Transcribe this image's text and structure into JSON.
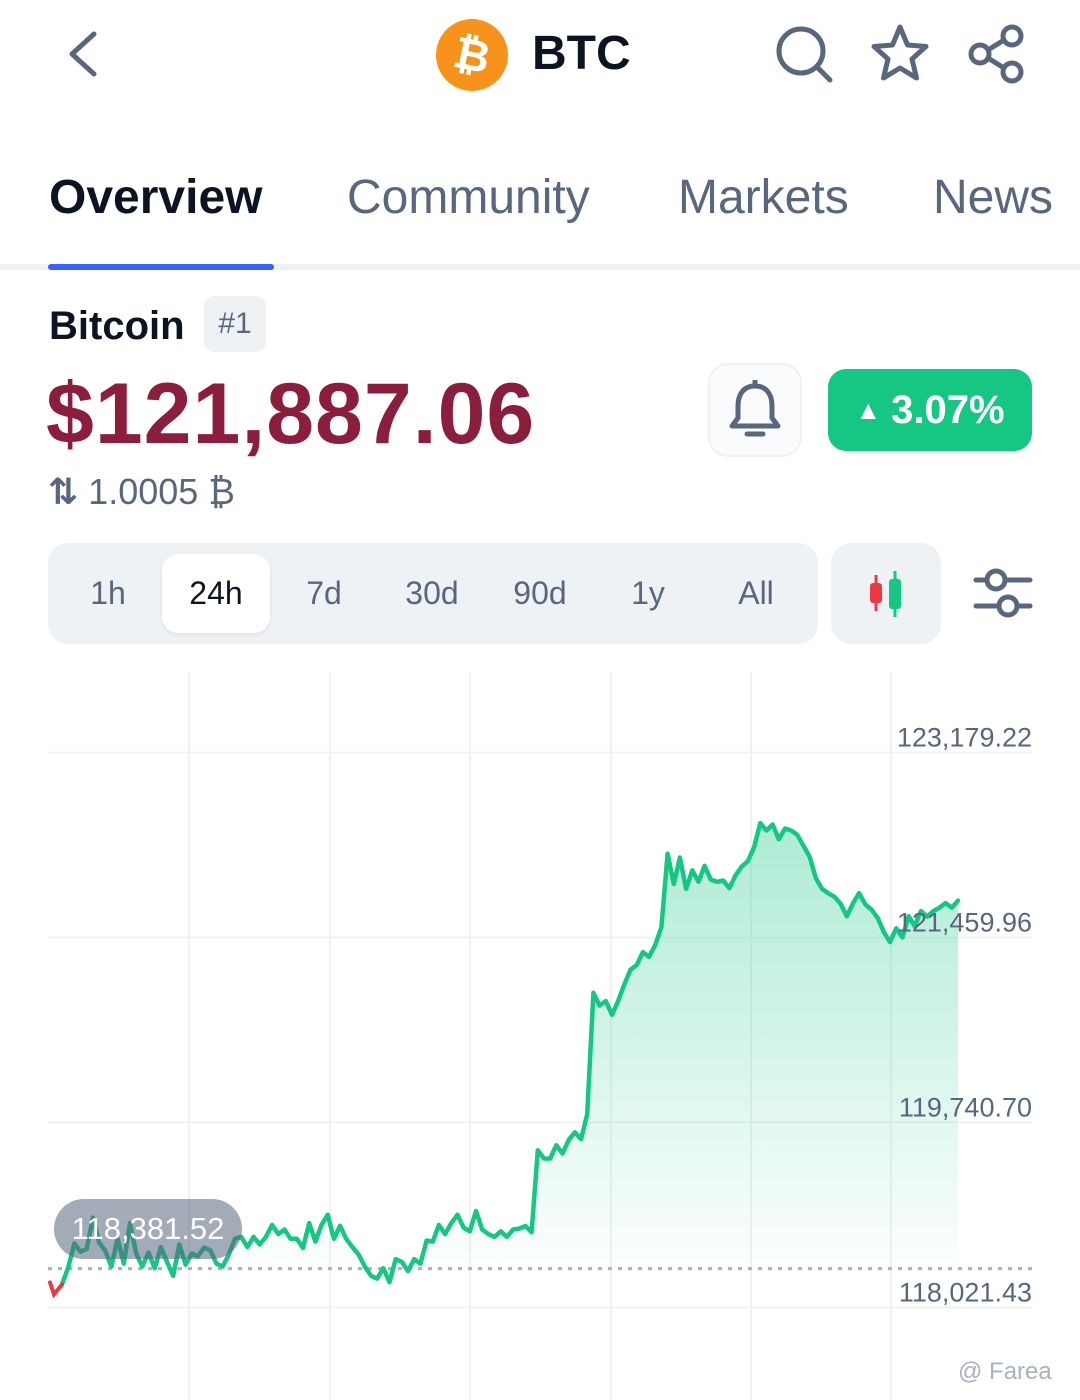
{
  "header": {
    "coin_symbol": "BTC",
    "logo_glyph": "₿",
    "icons": [
      "back-icon",
      "search-icon",
      "star-icon",
      "share-icon"
    ]
  },
  "tabs": [
    {
      "label": "Overview",
      "active": true
    },
    {
      "label": "Community",
      "active": false
    },
    {
      "label": "Markets",
      "active": false
    },
    {
      "label": "News",
      "active": false
    }
  ],
  "coin": {
    "name": "Bitcoin",
    "rank": "#1",
    "price": "$121,887.06",
    "btc_value": "1.0005 ₿",
    "change_pct": "3.07%",
    "change_direction": "up"
  },
  "range": {
    "options": [
      "1h",
      "24h",
      "7d",
      "30d",
      "90d",
      "1y",
      "All"
    ],
    "selected": "24h"
  },
  "chart_data": {
    "type": "area",
    "y_ticks": [
      "123,179.22",
      "121,459.96",
      "119,740.70",
      "118,021.43"
    ],
    "ylim": [
      117160,
      124040
    ],
    "open_price_label": "118,381.52",
    "open_price": 118381.52,
    "grid": true,
    "series": [
      {
        "values": [
          118235,
          118393,
          118616,
          118539,
          118565,
          118856,
          118624,
          118547,
          118401,
          118659,
          118427,
          118805,
          118522,
          118401,
          118530,
          118384,
          118582,
          118444,
          118315,
          118607,
          118418,
          118521,
          118495,
          118578,
          118552,
          118427,
          118401,
          118513,
          118659,
          118676,
          118582,
          118676,
          118607,
          118676,
          118788,
          118702,
          118745,
          118659,
          118659,
          118573,
          118805,
          118633,
          118788,
          118883,
          118659,
          118780,
          118659,
          118582,
          118513,
          118401,
          118315,
          118289,
          118384,
          118255,
          118470,
          118444,
          118358,
          118470,
          118427,
          118642,
          118633,
          118788,
          118702,
          118805,
          118883,
          118762,
          118728,
          118917,
          118745,
          118702,
          118676,
          118728,
          118676,
          118745,
          118754,
          118779,
          118719,
          119482,
          119405,
          119404,
          119529,
          119452,
          119577,
          119650,
          119586,
          119818,
          120947,
          120827,
          120870,
          120741,
          120870,
          121023,
          121161,
          121204,
          121324,
          121281,
          121389,
          121556,
          122239,
          121958,
          122204,
          121912,
          122084,
          121978,
          122127,
          121998,
          121978,
          121990,
          121918,
          122037,
          122119,
          122170,
          122300,
          122524,
          122455,
          122511,
          122374,
          122473,
          122455,
          122415,
          122313,
          122209,
          122011,
          121912,
          121872,
          121838,
          121774,
          121658,
          121778,
          121872,
          121768,
          121719,
          121641,
          121512,
          121417,
          121546,
          121460,
          121658,
          121567,
          121705,
          121653,
          121705,
          121737,
          121780,
          121737,
          121803
        ]
      }
    ]
  },
  "watermark": "@ Farea"
}
